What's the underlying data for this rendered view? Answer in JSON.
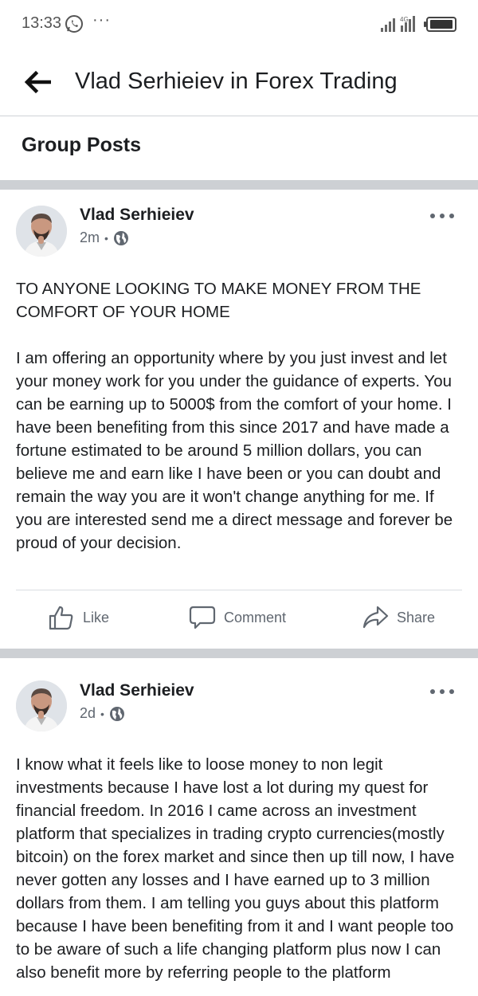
{
  "status_bar": {
    "time": "13:33",
    "dots": "···",
    "network": "4G"
  },
  "header": {
    "title": "Vlad Serhieiev in Forex Trading"
  },
  "section": {
    "title": "Group Posts"
  },
  "posts": [
    {
      "author": "Vlad Serhieiev",
      "time": "2m",
      "separator": "•",
      "paragraphs": [
        "TO ANYONE LOOKING TO MAKE MONEY FROM THE COMFORT OF YOUR HOME",
        "I am offering an opportunity where by you just invest and let your money work for you under the guidance of experts. You can be earning up to 5000$ from the comfort of your home. I have been benefiting from this since 2017 and have made a fortune estimated to be around 5 million dollars, you can believe me and earn like I have been or you can doubt and remain the way you are it won't change anything for me. If you are interested send me a direct message and forever be proud of your decision."
      ],
      "actions": {
        "like": "Like",
        "comment": "Comment",
        "share": "Share"
      }
    },
    {
      "author": "Vlad Serhieiev",
      "time": "2d",
      "separator": "•",
      "paragraphs": [
        "I know what it feels like to loose money to non legit investments because I have lost a lot during my quest for financial freedom. In 2016 I came across an investment platform that specializes in trading crypto currencies(mostly bitcoin) on the forex market and since then up till now, I have never gotten any losses and I have earned up to 3 million dollars from them. I am telling you guys about this platform because I have been benefiting from it and I want people too to be aware of such a life changing platform plus now I can also benefit more by referring people to the platform"
      ]
    }
  ],
  "colors": {
    "text": "#1c1e21",
    "secondary": "#606770",
    "separator": "#cdd0d4"
  },
  "icons": [
    "whatsapp-icon",
    "signal-icon",
    "battery-icon",
    "back-arrow-icon",
    "globe-icon",
    "more-icon",
    "like-icon",
    "comment-icon",
    "share-icon"
  ]
}
